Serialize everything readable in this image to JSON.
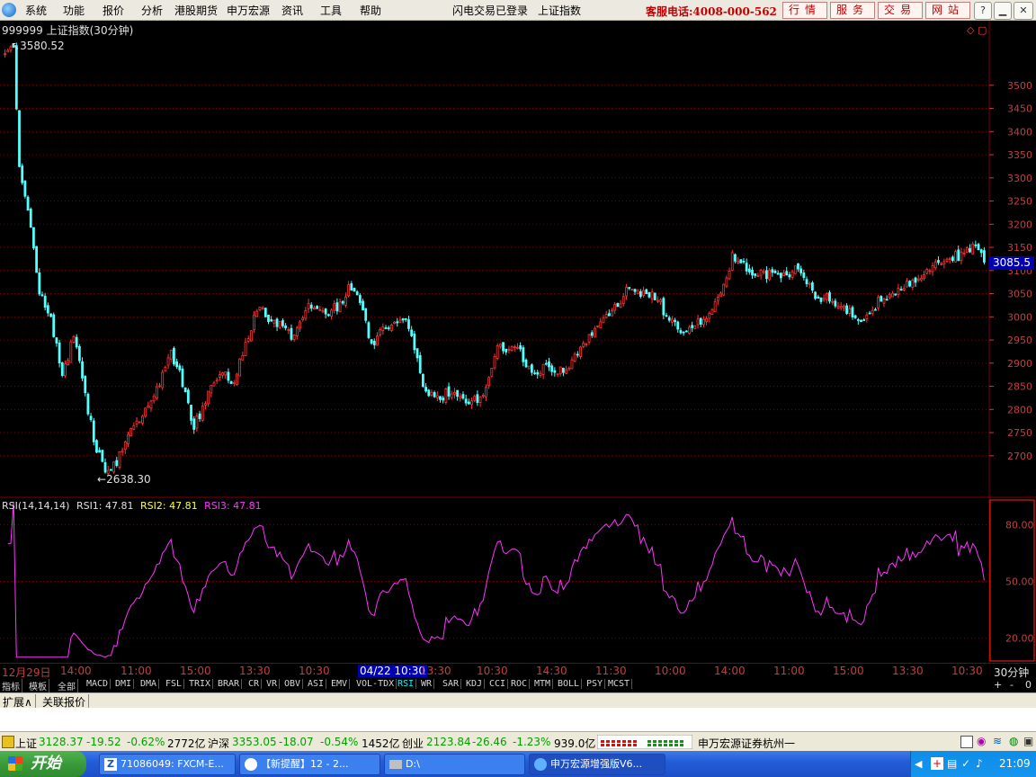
{
  "menubar": {
    "items": [
      "系统",
      "功能",
      "报价",
      "分析",
      "港股期货",
      "申万宏源",
      "资讯",
      "工具",
      "帮助"
    ],
    "status": "闪电交易已登录",
    "index_name": "上证指数",
    "hotline": "客服电话:4008-000-562",
    "right_buttons": [
      "行情",
      "服务",
      "交易",
      "网站"
    ]
  },
  "chart": {
    "title": "999999 上证指数(30分钟)",
    "high_label": "3580.52",
    "low_label": "2638.30",
    "current_price": "3085.5",
    "price_ticks": [
      "3500",
      "3450",
      "3400",
      "3350",
      "3300",
      "3250",
      "3200",
      "3150",
      "3100",
      "3050",
      "3000",
      "2950",
      "2900",
      "2850",
      "2800",
      "2750",
      "2700"
    ],
    "indicator_title": "RSI(14,14,14)",
    "rsi1": "RSI1: 47.81",
    "rsi2": "RSI2: 47.81",
    "rsi3": "RSI3: 47.81",
    "rsi_ticks": [
      "80.00",
      "50.00",
      "20.00"
    ],
    "colors": {
      "up": "#ff3333",
      "down": "#54ffff",
      "rsi": "#ff33ff",
      "grid": "#800000",
      "axis": "#c04040"
    }
  },
  "chart_data": {
    "type": "candlestick",
    "title": "999999 上证指数(30分钟)",
    "price_range": [
      2620,
      3620
    ],
    "rsi_range": [
      8,
      93
    ],
    "high": 3580.52,
    "low": 2638.3,
    "current": 3085.5,
    "x_labels": [
      "12月29日",
      "14:00",
      "11:00",
      "15:00",
      "13:30",
      "10:30",
      "04/22 10:30",
      "13:30",
      "10:30",
      "14:30",
      "11:30",
      "10:00",
      "14:00",
      "11:00",
      "15:00",
      "13:30",
      "10:30",
      "30分钟"
    ],
    "price_anchors": [
      [
        0,
        3560
      ],
      [
        3,
        3580
      ],
      [
        5,
        3320
      ],
      [
        8,
        3240
      ],
      [
        12,
        3050
      ],
      [
        16,
        3000
      ],
      [
        20,
        2870
      ],
      [
        24,
        2960
      ],
      [
        28,
        2830
      ],
      [
        32,
        2710
      ],
      [
        36,
        2660
      ],
      [
        40,
        2700
      ],
      [
        44,
        2760
      ],
      [
        48,
        2780
      ],
      [
        54,
        2860
      ],
      [
        58,
        2920
      ],
      [
        62,
        2860
      ],
      [
        66,
        2760
      ],
      [
        70,
        2820
      ],
      [
        75,
        2880
      ],
      [
        80,
        2860
      ],
      [
        84,
        2940
      ],
      [
        88,
        3020
      ],
      [
        94,
        2990
      ],
      [
        100,
        2960
      ],
      [
        106,
        3030
      ],
      [
        110,
        3010
      ],
      [
        116,
        3020
      ],
      [
        120,
        3060
      ],
      [
        124,
        3040
      ],
      [
        128,
        2940
      ],
      [
        132,
        2970
      ],
      [
        136,
        2990
      ],
      [
        140,
        3000
      ],
      [
        143,
        2930
      ],
      [
        146,
        2860
      ],
      [
        150,
        2820
      ],
      [
        156,
        2840
      ],
      [
        162,
        2810
      ],
      [
        168,
        2840
      ],
      [
        172,
        2930
      ],
      [
        178,
        2940
      ],
      [
        184,
        2880
      ],
      [
        190,
        2890
      ],
      [
        196,
        2880
      ],
      [
        202,
        2940
      ],
      [
        208,
        2990
      ],
      [
        214,
        3030
      ],
      [
        218,
        3060
      ],
      [
        224,
        3050
      ],
      [
        228,
        3040
      ],
      [
        232,
        2990
      ],
      [
        238,
        2960
      ],
      [
        244,
        3000
      ],
      [
        250,
        3040
      ],
      [
        254,
        3130
      ],
      [
        258,
        3110
      ],
      [
        264,
        3090
      ],
      [
        270,
        3090
      ],
      [
        276,
        3100
      ],
      [
        280,
        3080
      ],
      [
        284,
        3040
      ],
      [
        288,
        3040
      ],
      [
        294,
        3010
      ],
      [
        300,
        2990
      ],
      [
        306,
        3040
      ],
      [
        312,
        3060
      ],
      [
        318,
        3080
      ],
      [
        324,
        3110
      ],
      [
        328,
        3130
      ],
      [
        334,
        3130
      ],
      [
        338,
        3150
      ],
      [
        342,
        3120
      ]
    ]
  },
  "xaxis_unit": "30分钟",
  "tabs": {
    "items": [
      "指标",
      "模板",
      "全部",
      "MACD",
      "DMI",
      "DMA",
      "FSL",
      "TRIX",
      "BRAR",
      "CR",
      "VR",
      "OBV",
      "ASI",
      "EMV",
      "VOL-TDX",
      "RSI",
      "WR",
      "SAR",
      "KDJ",
      "CCI",
      "ROC",
      "MTM",
      "BOLL",
      "PSY",
      "MCST"
    ],
    "active": "RSI",
    "right_controls": [
      "+",
      "-",
      "0"
    ]
  },
  "extbar": {
    "items": [
      "扩展∧",
      "关联报价"
    ]
  },
  "ticker": {
    "sh_label": "上证",
    "sh_value": "3128.37",
    "sh_change": "-19.52",
    "sh_pct": "-0.62%",
    "sh_vol": "2772亿",
    "hs_label": "沪深",
    "hs_value": "3353.05",
    "hs_change": "-18.07",
    "hs_pct": "-0.54%",
    "hs_vol": "1452亿",
    "cy_label": "创业",
    "cy_value": "2123.84",
    "cy_change": "-26.46",
    "cy_pct": "-1.23%",
    "cy_vol": "939.0亿",
    "broker": "申万宏源证券杭州一"
  },
  "taskbar": {
    "start": "开始",
    "tasks": [
      "71086049: FXCM-E...",
      "【新提醒】12 - 2...",
      "D:\\",
      "申万宏源增强版V6..."
    ],
    "clock": "21:09"
  }
}
